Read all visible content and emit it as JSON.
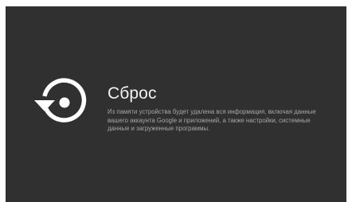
{
  "dialog": {
    "icon": "restore-icon",
    "title": "Сброс",
    "description_lines": [
      "Из памяти устройства будет удалена вся информация, включая данные",
      "вашего аккаунта Google и приложений, а также настройки, системные",
      "данные и загруженные программы."
    ]
  },
  "colors": {
    "background": "#303030",
    "title": "#f2f2f2",
    "description": "#a6a6a6",
    "icon": "#ffffff"
  }
}
